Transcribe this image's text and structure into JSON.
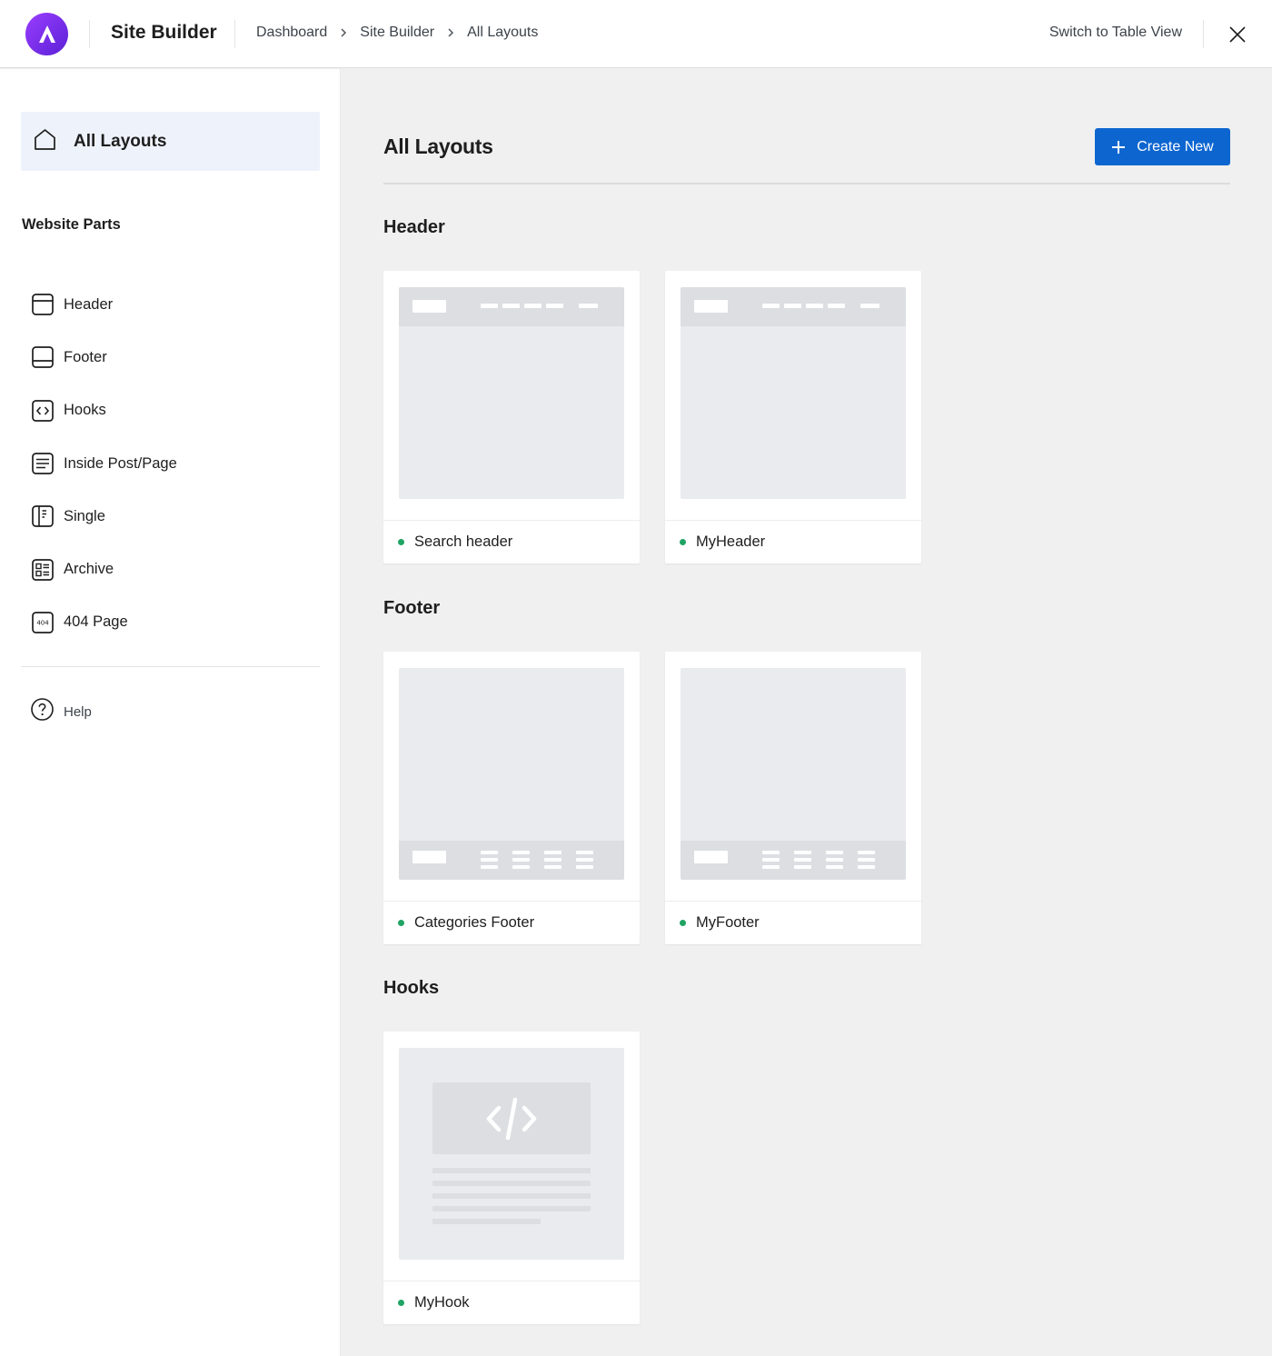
{
  "app": {
    "title": "Site Builder",
    "logo_icon": "astra-logo-icon",
    "brand_color": "#7b2ff2"
  },
  "breadcrumb": {
    "items": [
      "Dashboard",
      "Site Builder",
      "All Layouts"
    ]
  },
  "topbar": {
    "switch_view_label": "Switch to Table View",
    "close_icon": "close-icon"
  },
  "sidebar": {
    "all_layouts_label": "All Layouts",
    "section_label": "Website Parts",
    "items": [
      {
        "label": "Header",
        "icon": "header-layout-icon"
      },
      {
        "label": "Footer",
        "icon": "footer-layout-icon"
      },
      {
        "label": "Hooks",
        "icon": "code-brackets-icon"
      },
      {
        "label": "Inside Post/Page",
        "icon": "post-content-icon"
      },
      {
        "label": "Single",
        "icon": "single-layout-icon"
      },
      {
        "label": "Archive",
        "icon": "archive-grid-icon"
      },
      {
        "label": "404 Page",
        "icon": "404-icon",
        "icon_text": "404"
      }
    ],
    "help_label": "Help"
  },
  "main": {
    "title": "All Layouts",
    "create_button_label": "Create New",
    "accent_color": "#0d66d0",
    "status_color": "#1fa463",
    "groups": [
      {
        "title": "Header",
        "cards": [
          {
            "name": "Search header"
          },
          {
            "name": "MyHeader"
          }
        ]
      },
      {
        "title": "Footer",
        "cards": [
          {
            "name": "Categories Footer"
          },
          {
            "name": "MyFooter"
          }
        ]
      },
      {
        "title": "Hooks",
        "cards": [
          {
            "name": "MyHook"
          }
        ]
      }
    ]
  }
}
